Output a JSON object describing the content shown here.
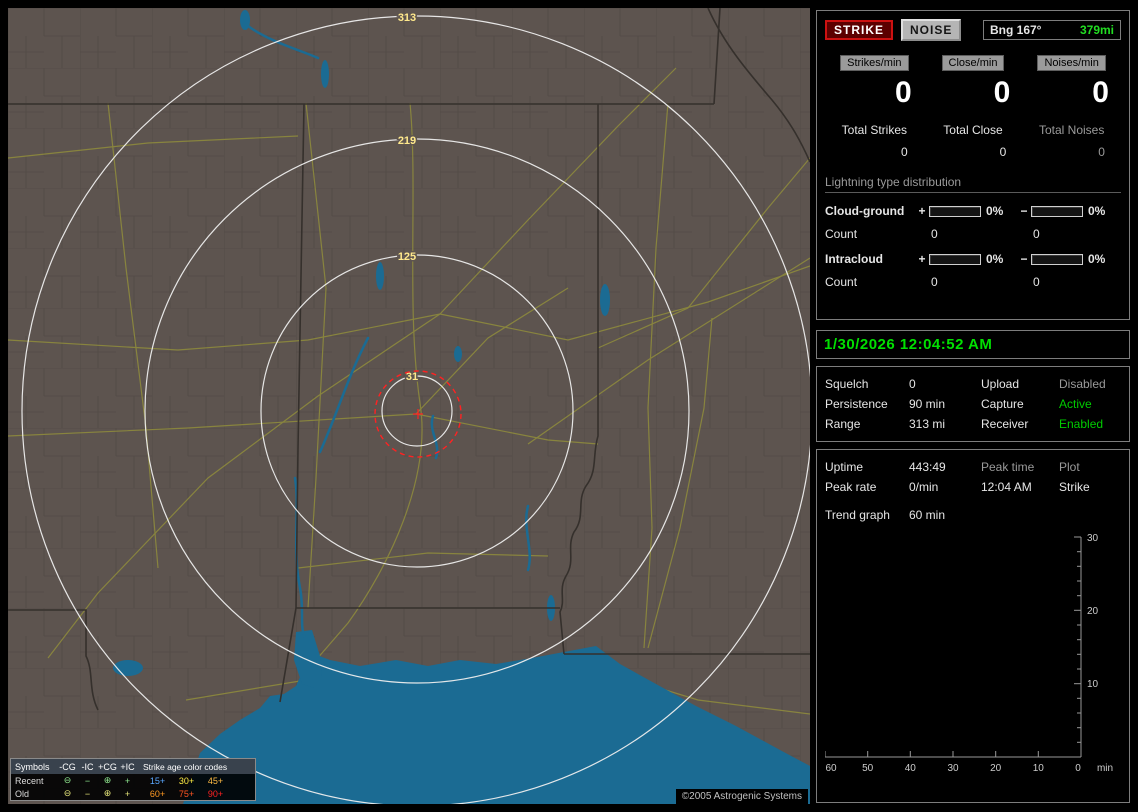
{
  "colors": {
    "accent_green": "#00cc00",
    "clock_green": "#00e000",
    "strike_red": "#cc1111",
    "dim_gray": "#9a9a9a",
    "ring_label_yellow": "#ffe98c",
    "water_blue": "#1b6b93",
    "land_brown": "#5d544f"
  },
  "map": {
    "ring_labels": [
      "313",
      "219",
      "125",
      "31"
    ],
    "copyright": "©2005 Astrogenic Systems",
    "legend": {
      "symbols_title": "Symbols",
      "col_headers": [
        "-CG",
        "-IC",
        "+CG",
        "+IC"
      ],
      "age_title": "Strike age color codes",
      "rows": [
        {
          "label": "Recent",
          "symbols": [
            "⊖",
            "−",
            "⊕",
            "+"
          ],
          "ages": [
            "15+",
            "30+",
            "45+"
          ]
        },
        {
          "label": "Old",
          "symbols": [
            "⊖",
            "−",
            "⊕",
            "+"
          ],
          "ages": [
            "60+",
            "75+",
            "90+"
          ]
        }
      ]
    }
  },
  "sidebar": {
    "strike_button": "STRIKE",
    "noise_button": "NOISE",
    "bearing_label": "Bng 167°",
    "bearing_value": "379mi",
    "rates": [
      {
        "label": "Strikes/min",
        "value": "0"
      },
      {
        "label": "Close/min",
        "value": "0"
      },
      {
        "label": "Noises/min",
        "value": "0"
      }
    ],
    "totals": [
      {
        "label": "Total Strikes",
        "value": "0"
      },
      {
        "label": "Total Close",
        "value": "0"
      },
      {
        "label": "Total Noises",
        "value": "0"
      }
    ],
    "distribution": {
      "title": "Lightning type distribution",
      "rows": [
        {
          "label": "Cloud-ground",
          "plus": "+",
          "plus_pct": "0%",
          "minus": "−",
          "minus_pct": "0%",
          "count_label": "Count",
          "plus_count": "0",
          "minus_count": "0"
        },
        {
          "label": "Intracloud",
          "plus": "+",
          "plus_pct": "0%",
          "minus": "−",
          "minus_pct": "0%",
          "count_label": "Count",
          "plus_count": "0",
          "minus_count": "0"
        }
      ]
    },
    "clock": "1/30/2026 12:04:52 AM",
    "status_rows": [
      {
        "label1": "Squelch",
        "value1": "0",
        "label2": "Upload",
        "value2": "Disabled"
      },
      {
        "label1": "Persistence",
        "value1": "90 min",
        "label2": "Capture",
        "value2": "Active"
      },
      {
        "label1": "Range",
        "value1": "313 mi",
        "label2": "Receiver",
        "value2": "Enabled"
      }
    ],
    "info_rows": [
      {
        "label1": "Uptime",
        "value1": "443:49",
        "label2": "Peak time",
        "value2": "Plot"
      },
      {
        "label1": "Peak rate",
        "value1": "0/min",
        "label2": "12:04 AM",
        "value2": "Strike"
      }
    ],
    "trend": {
      "label": "Trend graph",
      "value": "60 min"
    },
    "graph": {
      "y_ticks": [
        "30",
        "20",
        "10"
      ],
      "x_ticks": [
        "60",
        "50",
        "40",
        "30",
        "20",
        "10",
        "0"
      ],
      "unit": "min"
    }
  },
  "chart_data": {
    "type": "line",
    "title": "Strike trend graph (last 60 min)",
    "xlabel": "min",
    "ylabel": "",
    "x_ticks": [
      60,
      50,
      40,
      30,
      20,
      10,
      0
    ],
    "y_ticks": [
      30,
      20,
      10
    ],
    "ylim": [
      0,
      30
    ],
    "grid": false,
    "legend_position": "none",
    "series": [
      {
        "name": "Strike",
        "x": [],
        "values": []
      }
    ]
  }
}
